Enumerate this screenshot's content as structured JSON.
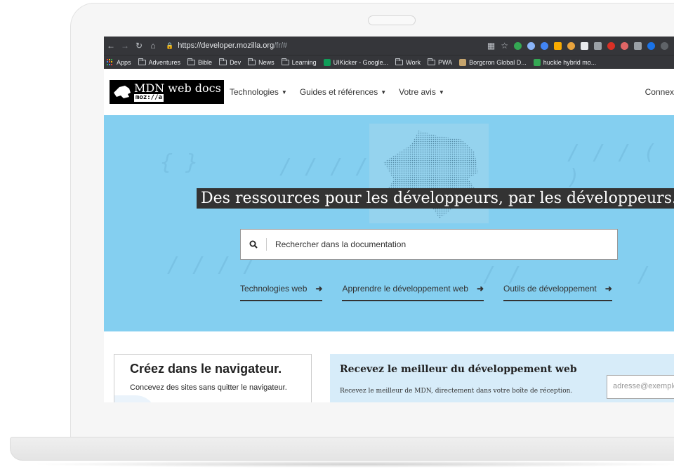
{
  "browser": {
    "url_host": "https://developer.mozilla.org",
    "url_path": "/fr/#",
    "bookmarks": [
      "Apps",
      "Adventures",
      "Bible",
      "Dev",
      "News",
      "Learning",
      "UIKicker - Google...",
      "Work",
      "PWA",
      "Borgcron Global D...",
      "huckle hybrid mo..."
    ],
    "extension_colors": [
      "#34a853",
      "#8ab4f8",
      "#4285f4",
      "#f9ab00",
      "#e8a33d",
      "#9aa0a6",
      "#d93025",
      "#e8eaed",
      "#d93025",
      "#e06666",
      "#1a73e8",
      "#9aa0a6"
    ]
  },
  "header": {
    "logo_title": "MDN web docs",
    "logo_sub": "moz://a",
    "menu": [
      "Technologies",
      "Guides et références",
      "Votre avis"
    ],
    "connect": "Connex"
  },
  "hero": {
    "title": "Des ressources pour les développeurs, par les développeurs.",
    "search_placeholder": "Rechercher dans la documentation",
    "links": [
      "Technologies web",
      "Apprendre le développement web",
      "Outils de développement"
    ],
    "background": "#84cff0"
  },
  "card": {
    "title": "Créez dans le navigateur.",
    "description": "Concevez des sites sans quitter le navigateur."
  },
  "newsletter": {
    "title": "Recevez le meilleur du développement web",
    "description": "Recevez le meilleur de MDN, directement dans votre boîte de réception.",
    "email_placeholder": "adresse@exemple"
  }
}
